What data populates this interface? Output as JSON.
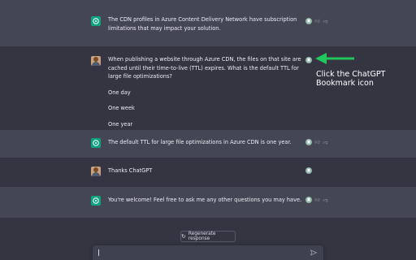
{
  "conversation": [
    {
      "role": "assistant",
      "lines": [
        "The CDN profiles in Azure Content Delivery Network have subscription limitations that may impact your solution."
      ]
    },
    {
      "role": "user",
      "lines": [
        "When publishing a website through Azure CDN, the files on that site are cached until their time-to-live (TTL) expires. What is the default TTL for large file optimizations?",
        "One day",
        "One week",
        "One year"
      ]
    },
    {
      "role": "assistant",
      "lines": [
        "The default TTL for large file optimizations in Azure CDN is one year."
      ]
    },
    {
      "role": "user",
      "lines": [
        "Thanks ChatGPT"
      ]
    },
    {
      "role": "assistant",
      "lines": [
        "You're welcome! Feel free to ask me any other questions you may have."
      ]
    }
  ],
  "annotation": {
    "text_line1": "Click the ChatGPT",
    "text_line2": "Bookmark icon",
    "arrow_color": "#22c55e"
  },
  "regenerate_label": "Regenerate response",
  "colors": {
    "page_bg": "#343541",
    "assistant_bg": "#444654",
    "gpt_avatar": "#10a37f"
  },
  "icons": {
    "bookmark": "bookmark-icon",
    "thumbs_up": "thumbs-up-icon",
    "thumbs_down": "thumbs-down-icon",
    "send": "send-icon",
    "regenerate": "refresh-icon"
  }
}
